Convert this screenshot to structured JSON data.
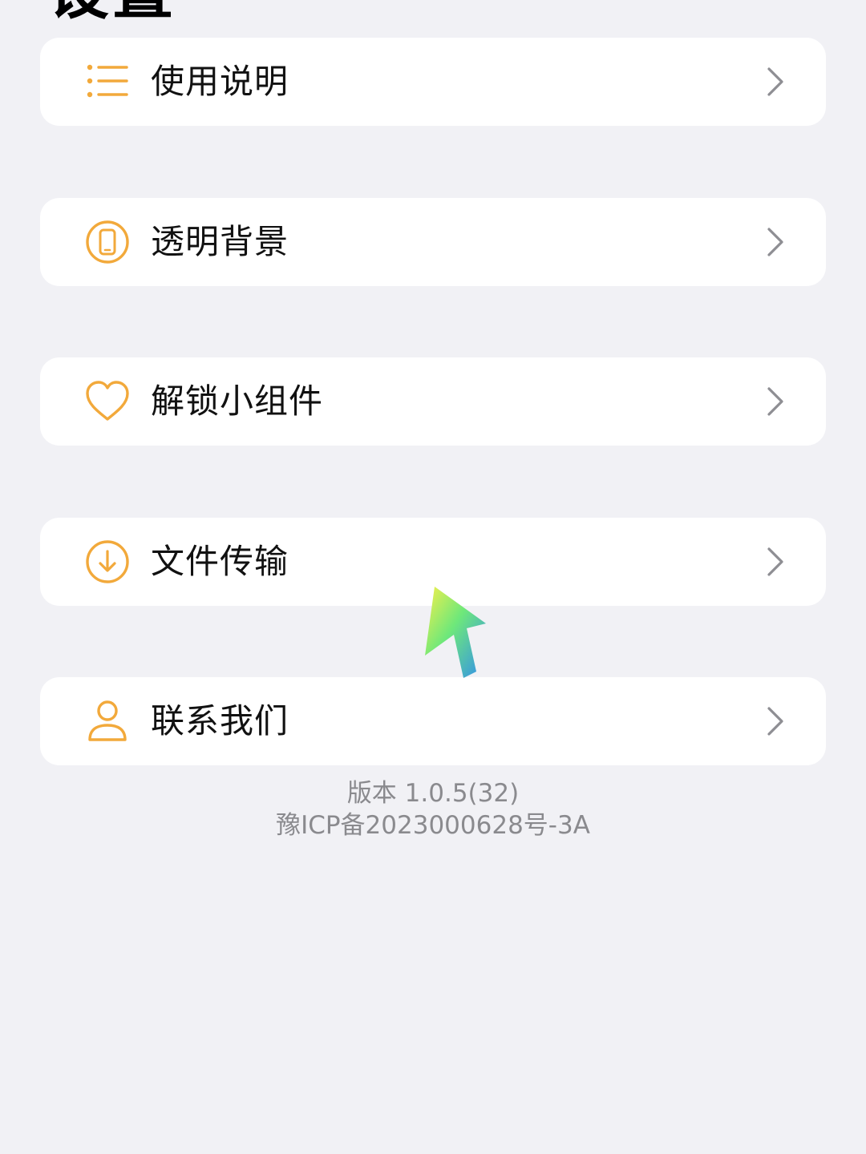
{
  "header": {
    "title": "设置"
  },
  "menu": {
    "items": [
      {
        "label": "使用说明",
        "icon": "list-icon"
      },
      {
        "label": "透明背景",
        "icon": "phone-icon"
      },
      {
        "label": "解锁小组件",
        "icon": "heart-icon"
      },
      {
        "label": "文件传输",
        "icon": "download-icon"
      },
      {
        "label": "联系我们",
        "icon": "person-icon"
      }
    ]
  },
  "footer": {
    "version": "版本   1.0.5(32)",
    "icp": "豫ICP备2023000628号-3A"
  },
  "colors": {
    "background": "#f1f1f5",
    "card": "#ffffff",
    "accent": "#f2a93b",
    "chevron": "#8e8e93",
    "footer_text": "#8a8a8e"
  }
}
